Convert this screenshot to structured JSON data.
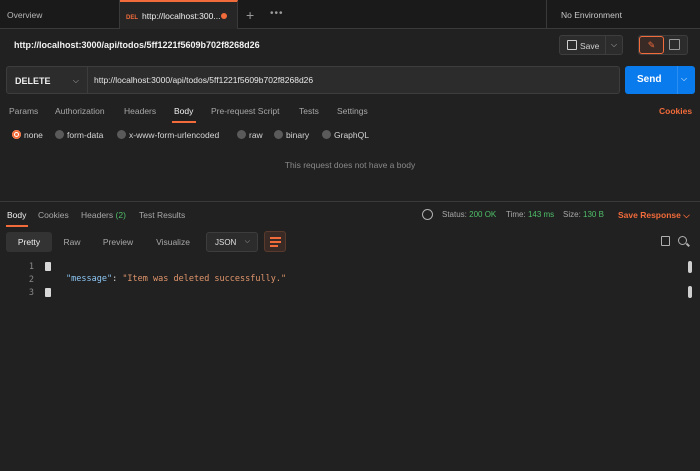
{
  "tabs": {
    "overview": "Overview",
    "active_method": "DEL",
    "active_title": "http://localhost:300...",
    "environment": "No Environment"
  },
  "request": {
    "title": "http://localhost:3000/api/todos/5ff1221f5609b702f8268d26",
    "save_label": "Save",
    "method": "DELETE",
    "url": "http://localhost:3000/api/todos/5ff1221f5609b702f8268d26",
    "send_label": "Send"
  },
  "request_tabs": [
    "Params",
    "Authorization",
    "Headers",
    "Body",
    "Pre-request Script",
    "Tests",
    "Settings"
  ],
  "cookies_label": "Cookies",
  "body_types": [
    "none",
    "form-data",
    "x-www-form-urlencoded",
    "raw",
    "binary",
    "GraphQL"
  ],
  "no_body_text": "This request does not have a body",
  "response": {
    "tabs": {
      "body": "Body",
      "cookies": "Cookies",
      "headers": "Headers",
      "headers_count": "(2)",
      "test_results": "Test Results"
    },
    "status_label": "Status:",
    "status_value": "200 OK",
    "time_label": "Time:",
    "time_value": "143 ms",
    "size_label": "Size:",
    "size_value": "130 B",
    "save_label": "Save Response",
    "formats": [
      "Pretty",
      "Raw",
      "Preview",
      "Visualize"
    ],
    "language": "JSON",
    "code": {
      "line_numbers": [
        "1",
        "2",
        "3"
      ],
      "key": "\"message\"",
      "colon": ": ",
      "value": "\"Item was deleted successfully.\""
    }
  },
  "colors": {
    "accent": "#f26b3a",
    "send": "#097bed",
    "success": "#4fbf6a",
    "background": "#212121"
  }
}
